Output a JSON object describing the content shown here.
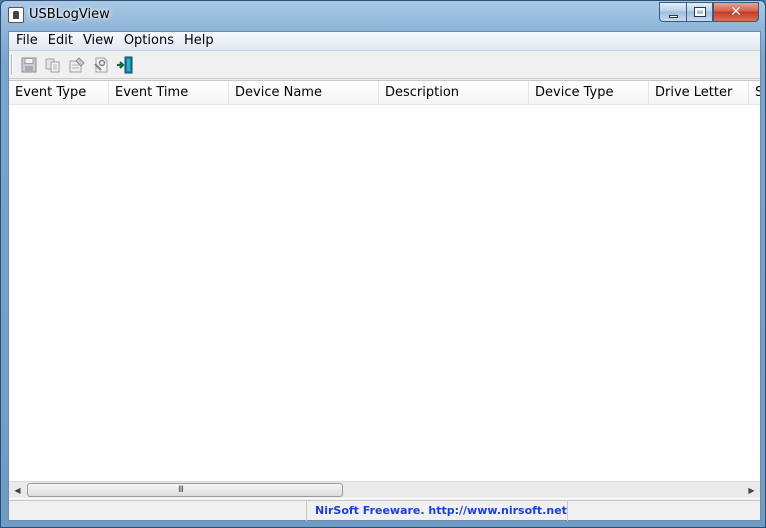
{
  "window": {
    "title": "USBLogView"
  },
  "menu": [
    "File",
    "Edit",
    "View",
    "Options",
    "Help"
  ],
  "toolbar": {
    "icons": [
      "save-icon",
      "copy-icon",
      "properties-icon",
      "html-report-icon",
      "exit-icon"
    ]
  },
  "table": {
    "columns": [
      "Event Type",
      "Event Time",
      "Device Name",
      "Description",
      "Device Type",
      "Drive Letter",
      "S"
    ],
    "rows": []
  },
  "scrollbar": {
    "grip": "III"
  },
  "status": {
    "left_text": "",
    "link_text": "NirSoft Freeware.  http://www.nirsoft.net"
  },
  "colors": {
    "link": "#1a3fd8",
    "close_button": "#c33d22"
  }
}
